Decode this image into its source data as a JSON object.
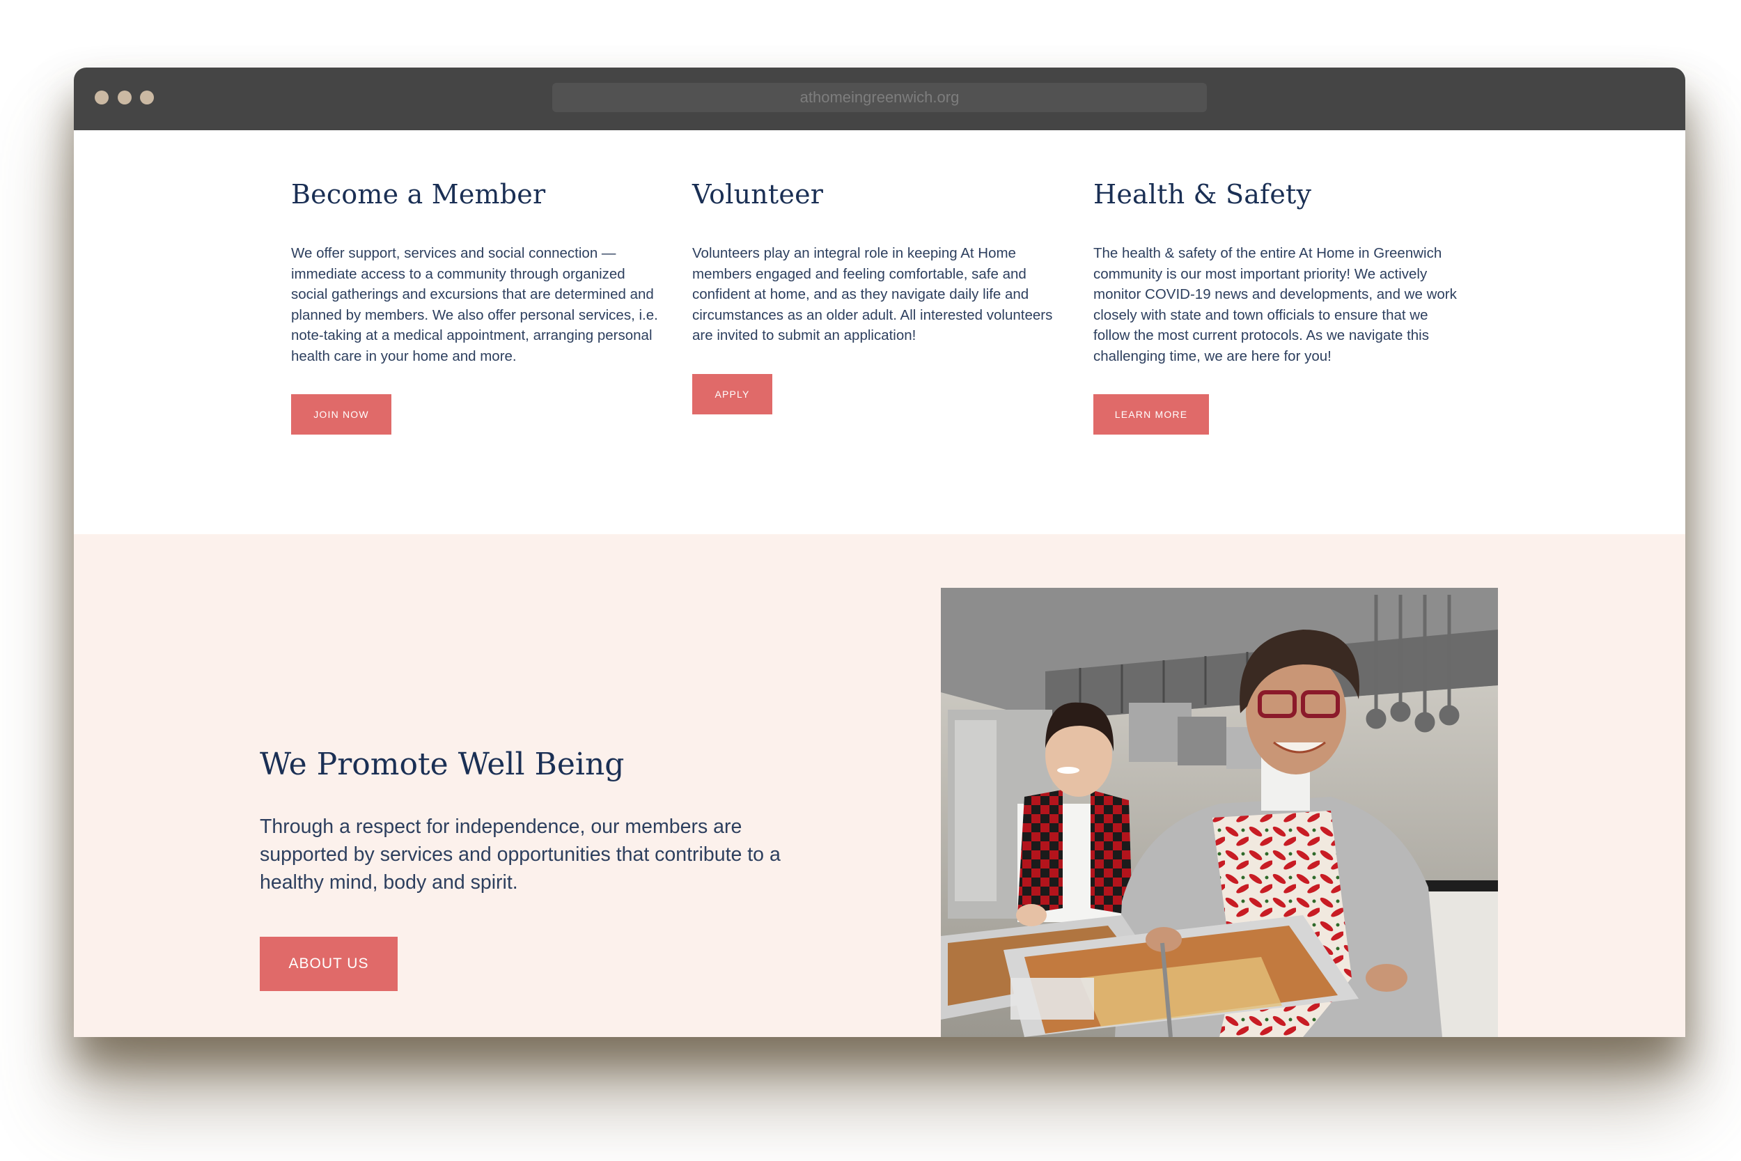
{
  "browser": {
    "url": "athomeingreenwich.org"
  },
  "cards": [
    {
      "title": "Become a Member",
      "text": "We offer support, services and social connection — immediate access to a community through organized social gatherings and excursions that are determined and planned by members. We also offer personal services, i.e. note-taking at a medical appointment, arranging personal health care in your home and more.",
      "button": "JOIN NOW"
    },
    {
      "title": "Volunteer",
      "text": "Volunteers play an integral role in keeping At Home members engaged and feeling comfortable, safe and confident at home, and as they navigate daily life and circumstances as an older adult. All interested volunteers are invited to submit an application!",
      "button": "APPLY"
    },
    {
      "title": "Health & Safety",
      "text": "The health & safety of the entire At Home in Greenwich community is our most important priority! We actively monitor COVID-19 news and developments, and we work closely with state and town officials to ensure that we follow the most current protocols. As we navigate this challenging time, we are here for you!",
      "button": "LEARN MORE"
    }
  ],
  "wellbeing": {
    "title": "We Promote Well Being",
    "text": "Through a respect for independence, our members are supported by services and opportunities that contribute to a healthy mind, body and spirit.",
    "button": "ABOUT US"
  },
  "colors": {
    "accent": "#e06a69",
    "heading": "#1a2f54",
    "band_bg": "#fcf1ec",
    "chrome": "#454545"
  }
}
